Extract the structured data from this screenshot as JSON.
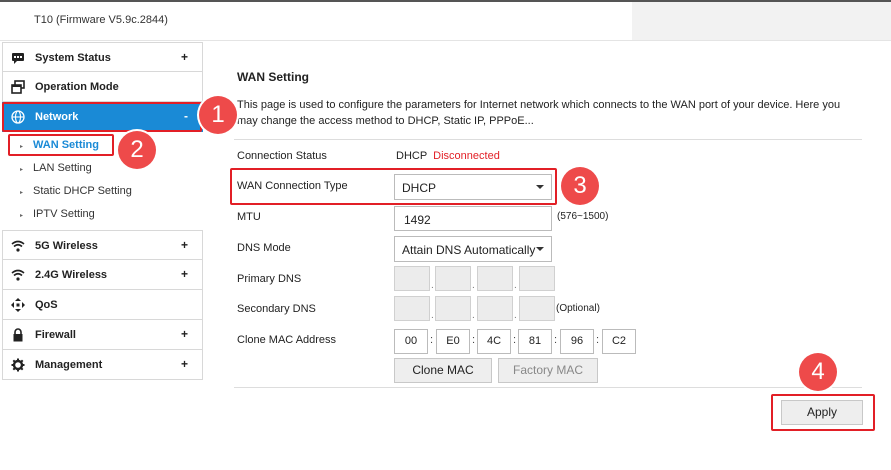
{
  "header": {
    "firmware_title": "T10 (Firmware V5.9c.2844)"
  },
  "sidebar": {
    "items": [
      {
        "label": "System Status",
        "icon": "message-icon",
        "expander": "+"
      },
      {
        "label": "Operation Mode",
        "icon": "window-icon",
        "expander": ""
      },
      {
        "label": "Network",
        "icon": "globe-icon",
        "expander": "-"
      },
      {
        "label": "5G Wireless",
        "icon": "wifi-icon",
        "expander": "+"
      },
      {
        "label": "2.4G Wireless",
        "icon": "wifi-icon",
        "expander": "+"
      },
      {
        "label": "QoS",
        "icon": "qos-arrows-icon",
        "expander": ""
      },
      {
        "label": "Firewall",
        "icon": "lock-icon",
        "expander": "+"
      },
      {
        "label": "Management",
        "icon": "gear-icon",
        "expander": "+"
      }
    ],
    "network_sub": [
      {
        "label": "WAN Setting"
      },
      {
        "label": "LAN Setting"
      },
      {
        "label": "Static DHCP Setting"
      },
      {
        "label": "IPTV Setting"
      }
    ]
  },
  "main": {
    "title": "WAN Setting",
    "description": "This page is used to configure the parameters for Internet network which connects to the WAN port of your device. Here you may change the access method to DHCP, Static IP, PPPoE...",
    "connection_status": {
      "label": "Connection Status",
      "mode": "DHCP",
      "state": "Disconnected"
    },
    "wan_type": {
      "label": "WAN Connection Type",
      "value": "DHCP"
    },
    "mtu": {
      "label": "MTU",
      "value": "1492",
      "hint": "(576~1500)"
    },
    "dns_mode": {
      "label": "DNS Mode",
      "value": "Attain DNS Automatically"
    },
    "primary_dns": {
      "label": "Primary DNS"
    },
    "secondary_dns": {
      "label": "Secondary DNS",
      "hint": "(Optional)"
    },
    "clone_mac": {
      "label": "Clone MAC Address",
      "octets": [
        "00",
        "E0",
        "4C",
        "81",
        "96",
        "C2"
      ]
    },
    "buttons": {
      "clone_mac": "Clone MAC",
      "factory_mac": "Factory MAC",
      "apply": "Apply"
    }
  },
  "annotations": {
    "badges": [
      "1",
      "2",
      "3",
      "4"
    ],
    "color": "#e21f26"
  },
  "colors": {
    "accent": "#1a8ad6",
    "alert": "#e21f26"
  }
}
